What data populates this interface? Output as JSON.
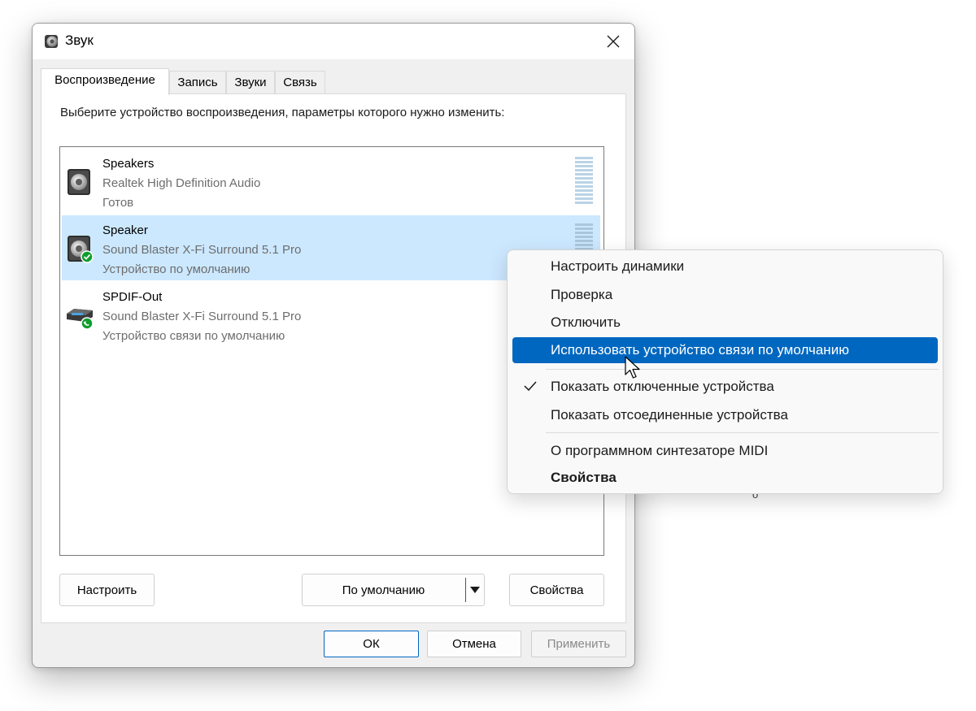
{
  "window": {
    "title": "Звук",
    "icon": "speaker-app-icon"
  },
  "tabs": [
    {
      "label": "Воспроизведение",
      "active": true
    },
    {
      "label": "Запись",
      "active": false
    },
    {
      "label": "Звуки",
      "active": false
    },
    {
      "label": "Связь",
      "active": false
    }
  ],
  "panel": {
    "instruction": "Выберите устройство воспроизведения, параметры которого нужно изменить:"
  },
  "devices": [
    {
      "name": "Speakers",
      "driver": "Realtek High Definition Audio",
      "status": "Готов",
      "icon": "speaker-icon",
      "selected": false
    },
    {
      "name": "Speaker",
      "driver": "Sound Blaster X-Fi Surround 5.1 Pro",
      "status": "Устройство по умолчанию",
      "icon": "speaker-default-icon",
      "selected": true
    },
    {
      "name": "SPDIF-Out",
      "driver": "Sound Blaster X-Fi Surround 5.1 Pro",
      "status": "Устройство связи по умолчанию",
      "icon": "spdif-comm-default-icon",
      "selected": false
    }
  ],
  "buttons": {
    "configure": "Настроить",
    "set_default": "По умолчанию",
    "properties": "Свойства"
  },
  "footer": {
    "ok": "ОК",
    "cancel": "Отмена",
    "apply": "Применить"
  },
  "context_menu": {
    "items": [
      {
        "label": "Настроить динамики"
      },
      {
        "label": "Проверка"
      },
      {
        "label": "Отключить"
      },
      {
        "label": "Использовать устройство связи по умолчанию",
        "highlighted": true
      },
      {
        "label": "Показать отключенные устройства",
        "checked": true
      },
      {
        "label": "Показать отсоединенные устройства"
      },
      {
        "label": "О программном синтезаторе MIDI"
      },
      {
        "label": "Свойства",
        "bold": true
      }
    ]
  },
  "stray_text": "о",
  "colors": {
    "selection": "#cce8ff",
    "menu_highlight": "#0067c0",
    "default_badge": "#0f9d2e"
  }
}
